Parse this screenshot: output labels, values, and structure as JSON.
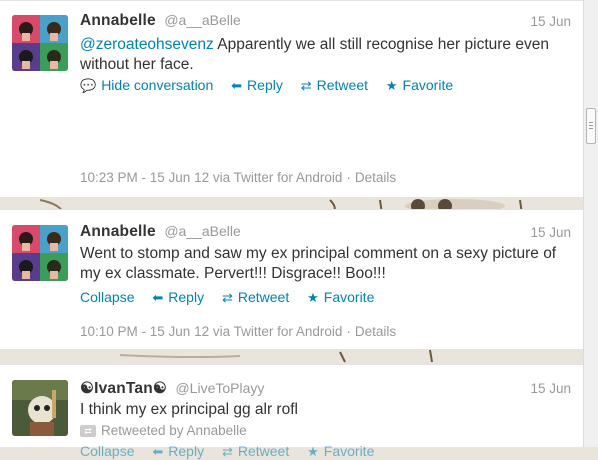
{
  "tweets": [
    {
      "name": "Annabelle",
      "handle": "@a__aBelle",
      "date": "15 Jun",
      "mention": "@zeroateohsevenz",
      "text": " Apparently we all still recognise her picture even without her face.",
      "actions": {
        "expand": "Hide conversation",
        "reply": "Reply",
        "retweet": "Retweet",
        "favorite": "Favorite"
      },
      "meta": {
        "time": "10:23 PM - 15 Jun 12 via Twitter for Android",
        "sep": "·",
        "details": "Details"
      }
    },
    {
      "name": "Annabelle",
      "handle": "@a__aBelle",
      "date": "15 Jun",
      "text": "Went to stomp and saw my ex principal comment on a sexy picture of my ex classmate. Pervert!!! Disgrace!! Boo!!!",
      "actions": {
        "expand": "Collapse",
        "reply": "Reply",
        "retweet": "Retweet",
        "favorite": "Favorite"
      },
      "meta": {
        "time": "10:10 PM - 15 Jun 12 via Twitter for Android",
        "sep": "·",
        "details": "Details"
      }
    },
    {
      "name": "☯IvanTan☯",
      "handle": "@LiveToPlayy",
      "date": "15 Jun",
      "text": "I think my ex principal gg alr rofl",
      "retweeted_by": "Retweeted by Annabelle",
      "actions": {
        "expand": "Collapse",
        "reply": "Reply",
        "retweet": "Retweet",
        "favorite": "Favorite"
      }
    }
  ],
  "icons": {
    "expand": "speech-bubble-icon",
    "reply": "reply-arrow-icon",
    "retweet": "retweet-icon",
    "favorite": "star-icon"
  },
  "colors": {
    "link": "#0084b4",
    "muted": "#999999",
    "text": "#333333"
  }
}
